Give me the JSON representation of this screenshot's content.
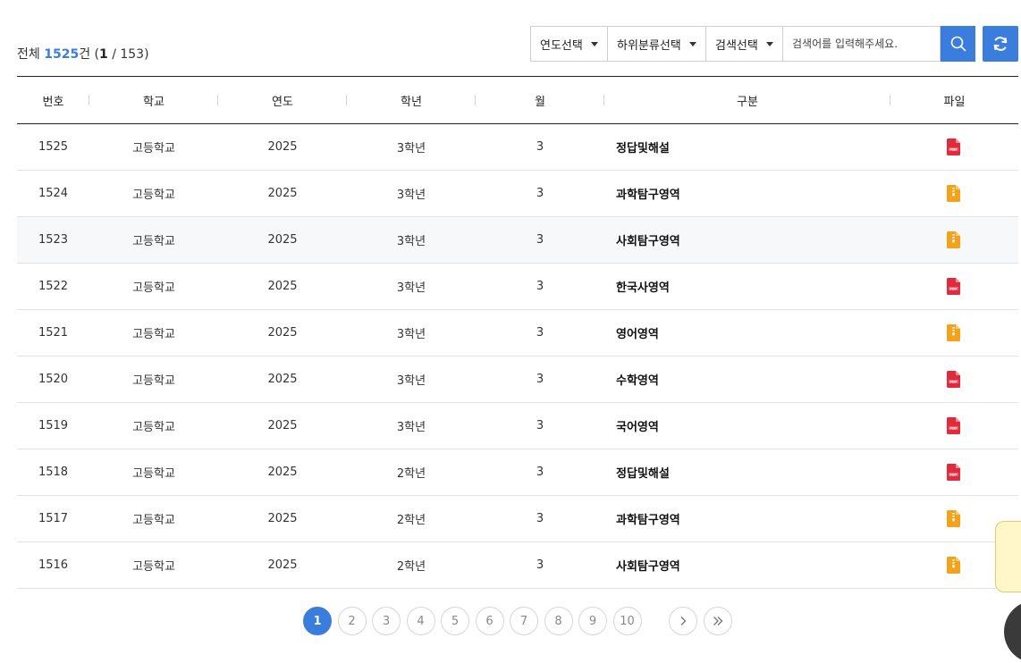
{
  "summary": {
    "label": "전체",
    "total": "1525",
    "unit": "건",
    "page_open": "(",
    "current_page": "1",
    "page_sep": " / 153)"
  },
  "filters": {
    "year_label": "연도선택",
    "subcategory_label": "하위분류선택",
    "search_type_label": "검색선택",
    "search_placeholder": "검색어를 입력해주세요."
  },
  "table": {
    "headers": [
      "번호",
      "학교",
      "연도",
      "학년",
      "월",
      "구분",
      "파일"
    ],
    "rows": [
      {
        "no": "1525",
        "school": "고등학교",
        "year": "2025",
        "grade": "3학년",
        "month": "3",
        "category": "정답및해설",
        "file": "pdf-icon"
      },
      {
        "no": "1524",
        "school": "고등학교",
        "year": "2025",
        "grade": "3학년",
        "month": "3",
        "category": "과학탐구영역",
        "file": "zip-icon"
      },
      {
        "no": "1523",
        "school": "고등학교",
        "year": "2025",
        "grade": "3학년",
        "month": "3",
        "category": "사회탐구영역",
        "file": "zip-icon"
      },
      {
        "no": "1522",
        "school": "고등학교",
        "year": "2025",
        "grade": "3학년",
        "month": "3",
        "category": "한국사영역",
        "file": "pdf-icon"
      },
      {
        "no": "1521",
        "school": "고등학교",
        "year": "2025",
        "grade": "3학년",
        "month": "3",
        "category": "영어영역",
        "file": "zip-icon"
      },
      {
        "no": "1520",
        "school": "고등학교",
        "year": "2025",
        "grade": "3학년",
        "month": "3",
        "category": "수학영역",
        "file": "pdf-icon"
      },
      {
        "no": "1519",
        "school": "고등학교",
        "year": "2025",
        "grade": "3학년",
        "month": "3",
        "category": "국어영역",
        "file": "pdf-icon"
      },
      {
        "no": "1518",
        "school": "고등학교",
        "year": "2025",
        "grade": "2학년",
        "month": "3",
        "category": "정답및해설",
        "file": "pdf-icon"
      },
      {
        "no": "1517",
        "school": "고등학교",
        "year": "2025",
        "grade": "2학년",
        "month": "3",
        "category": "과학탐구영역",
        "file": "zip-icon"
      },
      {
        "no": "1516",
        "school": "고등학교",
        "year": "2025",
        "grade": "2학년",
        "month": "3",
        "category": "사회탐구영역",
        "file": "zip-icon"
      }
    ]
  },
  "pagination": {
    "pages": [
      "1",
      "2",
      "3",
      "4",
      "5",
      "6",
      "7",
      "8",
      "9",
      "10"
    ],
    "active": "1"
  },
  "colors": {
    "accent": "#3b7ddd",
    "pdf": "#e02b3c",
    "zip": "#f3a21c"
  }
}
